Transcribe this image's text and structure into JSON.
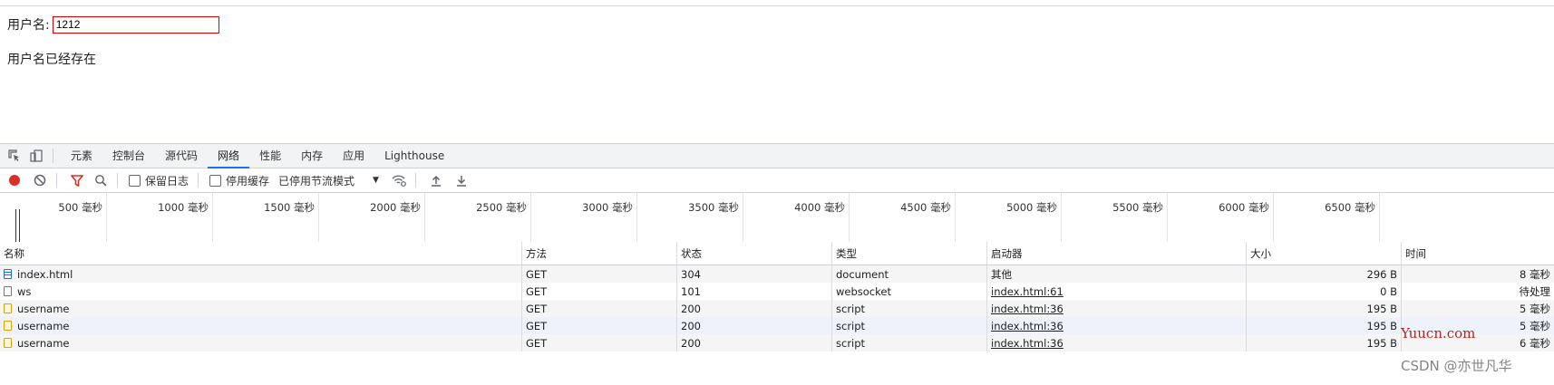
{
  "page": {
    "username_label": "用户名:",
    "username_value": "1212",
    "message": "用户名已经存在"
  },
  "devtools": {
    "tabs": [
      "元素",
      "控制台",
      "源代码",
      "网络",
      "性能",
      "内存",
      "应用",
      "Lighthouse"
    ],
    "active_tab": "网络",
    "toolbar": {
      "preserve_log": "保留日志",
      "disable_cache": "停用缓存",
      "throttling": "已停用节流模式"
    },
    "timeline_labels": [
      "500 毫秒",
      "1000 毫秒",
      "1500 毫秒",
      "2000 毫秒",
      "2500 毫秒",
      "3000 毫秒",
      "3500 毫秒",
      "4000 毫秒",
      "4500 毫秒",
      "5000 毫秒",
      "5500 毫秒",
      "6000 毫秒",
      "6500 毫秒"
    ],
    "columns": {
      "name": "名称",
      "method": "方法",
      "status": "状态",
      "type": "类型",
      "initiator": "启动器",
      "size": "大小",
      "time": "时间"
    },
    "rows": [
      {
        "name": "index.html",
        "method": "GET",
        "status": "304",
        "type": "document",
        "initiator": "其他",
        "size": "296 B",
        "time": "8 毫秒",
        "icon": "document-icon"
      },
      {
        "name": "ws",
        "method": "GET",
        "status": "101",
        "type": "websocket",
        "initiator": "index.html:61",
        "size": "0 B",
        "time": "待处理",
        "icon": "websocket-icon"
      },
      {
        "name": "username",
        "method": "GET",
        "status": "200",
        "type": "script",
        "initiator": "index.html:36",
        "size": "195 B",
        "time": "5 毫秒",
        "icon": "script-icon"
      },
      {
        "name": "username",
        "method": "GET",
        "status": "200",
        "type": "script",
        "initiator": "index.html:36",
        "size": "195 B",
        "time": "5 毫秒",
        "icon": "script-icon"
      },
      {
        "name": "username",
        "method": "GET",
        "status": "200",
        "type": "script",
        "initiator": "index.html:36",
        "size": "195 B",
        "time": "6 毫秒",
        "icon": "script-icon"
      }
    ]
  },
  "watermarks": {
    "yuucn": "Yuucn.com",
    "csdn": "CSDN @亦世凡华"
  },
  "colors": {
    "accent": "#1a73e8",
    "record": "#d93025",
    "filter": "#d93025",
    "input_border": "#e00000"
  }
}
